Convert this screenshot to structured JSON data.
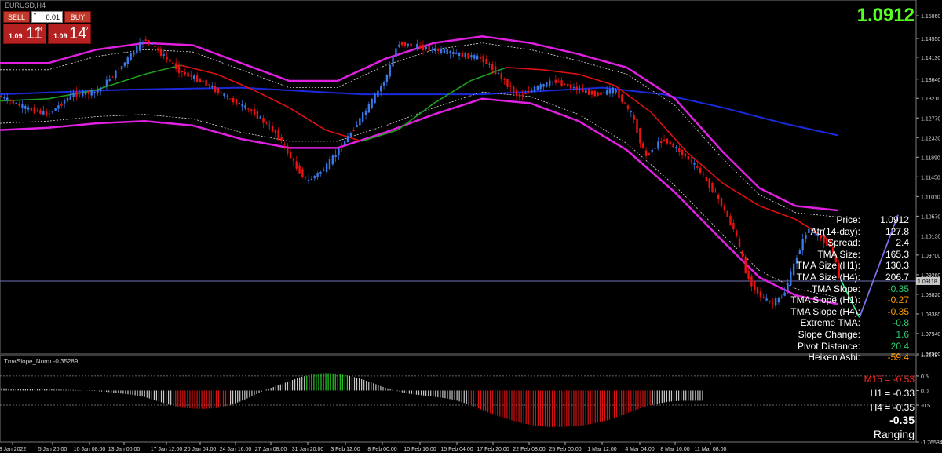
{
  "symbol_title": "EURUSD,H4",
  "trade_panel": {
    "sell_label": "SELL",
    "buy_label": "BUY",
    "lot_value": "0.01",
    "sell_small": "1.09",
    "sell_big": "11",
    "sell_sup": "8",
    "buy_small": "1.09",
    "buy_big": "14",
    "buy_sup": "2"
  },
  "big_price": "1.0912",
  "stats": [
    {
      "label": "Price:",
      "value": "1.0912",
      "color": "#ffffff"
    },
    {
      "label": "Atr(14-day):",
      "value": "127.8",
      "color": "#ffffff"
    },
    {
      "label": "Spread:",
      "value": "2.4",
      "color": "#ffffff"
    },
    {
      "label": "TMA Size:",
      "value": "165.3",
      "color": "#ffffff"
    },
    {
      "label": "TMA Size (H1):",
      "value": "130.3",
      "color": "#ffffff"
    },
    {
      "label": "TMA Size (H4):",
      "value": "206.7",
      "color": "#ffffff"
    },
    {
      "label": "TMA Slope:",
      "value": "-0.35",
      "color": "#2ecc71"
    },
    {
      "label": "TMA Slope (H1):",
      "value": "-0.27",
      "color": "#ff9900"
    },
    {
      "label": "TMA Slope (H4):",
      "value": "-0.35",
      "color": "#ff9900"
    },
    {
      "label": "Extreme TMA:",
      "value": "-0.8",
      "color": "#2ecc71"
    },
    {
      "label": "Slope Change:",
      "value": "1.6",
      "color": "#2ecc71"
    },
    {
      "label": "Pivot Distance:",
      "value": "20.4",
      "color": "#2ecc71"
    },
    {
      "label": "Heiken Ashi:",
      "value": "-59.4",
      "color": "#ff9900"
    }
  ],
  "oscillator": {
    "name": "TmaSlope_Norm -0.35289",
    "m15_text": "M15 = -0.53",
    "h1_text": "H1 = -0.33",
    "h4_text": "H4 = -0.35",
    "value_text": "-0.35",
    "state_text": "Ranging"
  },
  "chart_data": [
    {
      "type": "line",
      "price_ticks": [
        "1.15060",
        "1.14550",
        "1.14130",
        "1.13640",
        "1.13210",
        "1.12770",
        "1.12330",
        "1.11890",
        "1.11450",
        "1.11010",
        "1.10570",
        "1.10130",
        "1.09700",
        "1.09260",
        "1.08820",
        "1.08380",
        "1.07940",
        "1.07500"
      ],
      "current_price_label": "1.09118",
      "ylim": [
        1.075,
        1.1506
      ],
      "x_ticks": [
        "3 Jan 2022",
        "5 Jan 20:00",
        "10 Jan 08:00",
        "13 Jan 00:00",
        "17 Jan 12:00",
        "20 Jan 04:00",
        "24 Jan 16:00",
        "27 Jan 08:00",
        "31 Jan 20:00",
        "3 Feb 12:00",
        "8 Feb 00:00",
        "10 Feb 16:00",
        "15 Feb 04:00",
        "17 Feb 20:00",
        "22 Feb 08:00",
        "25 Feb 00:00",
        "1 Mar 12:00",
        "4 Mar 04:00",
        "8 Mar 16:00",
        "11 Mar 08:00"
      ],
      "price_path": [
        [
          0,
          1.1325
        ],
        [
          2,
          1.13
        ],
        [
          4,
          1.1285
        ],
        [
          6,
          1.133
        ],
        [
          8,
          1.1335
        ],
        [
          10,
          1.139
        ],
        [
          12,
          1.1455
        ],
        [
          13,
          1.143
        ],
        [
          15,
          1.138
        ],
        [
          17,
          1.1355
        ],
        [
          19,
          1.132
        ],
        [
          21,
          1.129
        ],
        [
          23,
          1.124
        ],
        [
          24.5,
          1.117
        ],
        [
          25.5,
          1.1135
        ],
        [
          27,
          1.1165
        ],
        [
          29,
          1.124
        ],
        [
          30.5,
          1.13
        ],
        [
          32,
          1.1365
        ],
        [
          33,
          1.1445
        ],
        [
          34,
          1.144
        ],
        [
          36,
          1.143
        ],
        [
          38,
          1.142
        ],
        [
          40,
          1.141
        ],
        [
          41.5,
          1.137
        ],
        [
          43,
          1.1325
        ],
        [
          44.5,
          1.1345
        ],
        [
          46,
          1.136
        ],
        [
          48,
          1.134
        ],
        [
          49.5,
          1.133
        ],
        [
          51,
          1.134
        ],
        [
          52.5,
          1.128
        ],
        [
          53.5,
          1.119
        ],
        [
          55,
          1.123
        ],
        [
          56.5,
          1.12
        ],
        [
          58,
          1.116
        ],
        [
          59.5,
          1.11
        ],
        [
          61,
          1.102
        ],
        [
          62,
          1.092
        ],
        [
          63,
          1.088
        ],
        [
          64,
          1.086
        ],
        [
          65,
          1.088
        ],
        [
          66,
          1.096
        ],
        [
          67,
          1.103
        ],
        [
          68,
          1.101
        ],
        [
          69,
          1.0985
        ],
        [
          69.7,
          1.0912
        ]
      ],
      "upper_band": [
        [
          0,
          1.14
        ],
        [
          4,
          1.14
        ],
        [
          8,
          1.143
        ],
        [
          12,
          1.1445
        ],
        [
          16,
          1.144
        ],
        [
          20,
          1.14
        ],
        [
          24,
          1.136
        ],
        [
          28,
          1.136
        ],
        [
          32,
          1.141
        ],
        [
          36,
          1.1445
        ],
        [
          40,
          1.146
        ],
        [
          44,
          1.1445
        ],
        [
          48,
          1.142
        ],
        [
          52,
          1.139
        ],
        [
          56,
          1.132
        ],
        [
          60,
          1.12
        ],
        [
          63,
          1.112
        ],
        [
          66,
          1.108
        ],
        [
          69.5,
          1.107
        ]
      ],
      "lower_band": [
        [
          0,
          1.125
        ],
        [
          4,
          1.1255
        ],
        [
          8,
          1.1265
        ],
        [
          12,
          1.127
        ],
        [
          16,
          1.126
        ],
        [
          20,
          1.123
        ],
        [
          24,
          1.121
        ],
        [
          28,
          1.121
        ],
        [
          32,
          1.1245
        ],
        [
          36,
          1.1285
        ],
        [
          40,
          1.132
        ],
        [
          44,
          1.131
        ],
        [
          48,
          1.127
        ],
        [
          52,
          1.1205
        ],
        [
          56,
          1.111
        ],
        [
          60,
          1.1
        ],
        [
          63,
          1.092
        ],
        [
          66,
          1.088
        ],
        [
          69.5,
          1.086
        ]
      ],
      "ma_line": [
        [
          0,
          1.1315
        ],
        [
          4,
          1.132
        ],
        [
          8,
          1.134
        ],
        [
          12,
          1.1375
        ],
        [
          15,
          1.1395
        ],
        [
          18,
          1.1375
        ],
        [
          21,
          1.134
        ],
        [
          24,
          1.13
        ],
        [
          27,
          1.125
        ],
        [
          30,
          1.1225
        ],
        [
          33,
          1.125
        ],
        [
          36,
          1.131
        ],
        [
          39,
          1.136
        ],
        [
          42,
          1.139
        ],
        [
          45,
          1.1385
        ],
        [
          48,
          1.1375
        ],
        [
          51,
          1.135
        ],
        [
          54,
          1.129
        ],
        [
          57,
          1.12
        ],
        [
          60,
          1.113
        ],
        [
          63,
          1.108
        ],
        [
          66,
          1.105
        ],
        [
          69,
          1.1
        ]
      ],
      "slow_ma_line": [
        [
          0,
          1.133
        ],
        [
          10,
          1.134
        ],
        [
          20,
          1.1345
        ],
        [
          30,
          1.133
        ],
        [
          40,
          1.133
        ],
        [
          50,
          1.1345
        ],
        [
          55,
          1.133
        ],
        [
          60,
          1.13
        ],
        [
          65,
          1.1265
        ],
        [
          69.5,
          1.1238
        ]
      ],
      "projection": [
        [
          69.8,
          1.0912
        ],
        [
          71.3,
          1.083
        ],
        [
          74.5,
          1.106
        ]
      ]
    },
    {
      "type": "bar",
      "name": "TmaSlope_Norm -0.35289",
      "yticks": [
        "1.2248",
        "0.5",
        "0.0",
        "-0.5",
        "-1.76584"
      ],
      "ylim": [
        -1.76584,
        1.2248
      ],
      "values": [
        0.08,
        0.06,
        0.05,
        0.05,
        0.04,
        0.03,
        0.02,
        0.0,
        -0.02,
        -0.05,
        -0.1,
        -0.15,
        -0.22,
        -0.35,
        -0.48,
        -0.58,
        -0.62,
        -0.63,
        -0.6,
        -0.52,
        -0.38,
        -0.2,
        0.0,
        0.15,
        0.3,
        0.45,
        0.55,
        0.6,
        0.58,
        0.52,
        0.42,
        0.28,
        0.12,
        0.0,
        -0.1,
        -0.15,
        -0.2,
        -0.25,
        -0.32,
        -0.45,
        -0.62,
        -0.78,
        -0.92,
        -1.05,
        -1.15,
        -1.22,
        -1.25,
        -1.25,
        -1.22,
        -1.18,
        -1.1,
        -1.0,
        -0.85,
        -0.7,
        -0.55,
        -0.45,
        -0.38,
        -0.35,
        -0.35
      ],
      "colors": {
        "up_strong": "#22cc22",
        "down_strong": "#dd1111",
        "neutral": "#c8c8c8"
      }
    }
  ]
}
